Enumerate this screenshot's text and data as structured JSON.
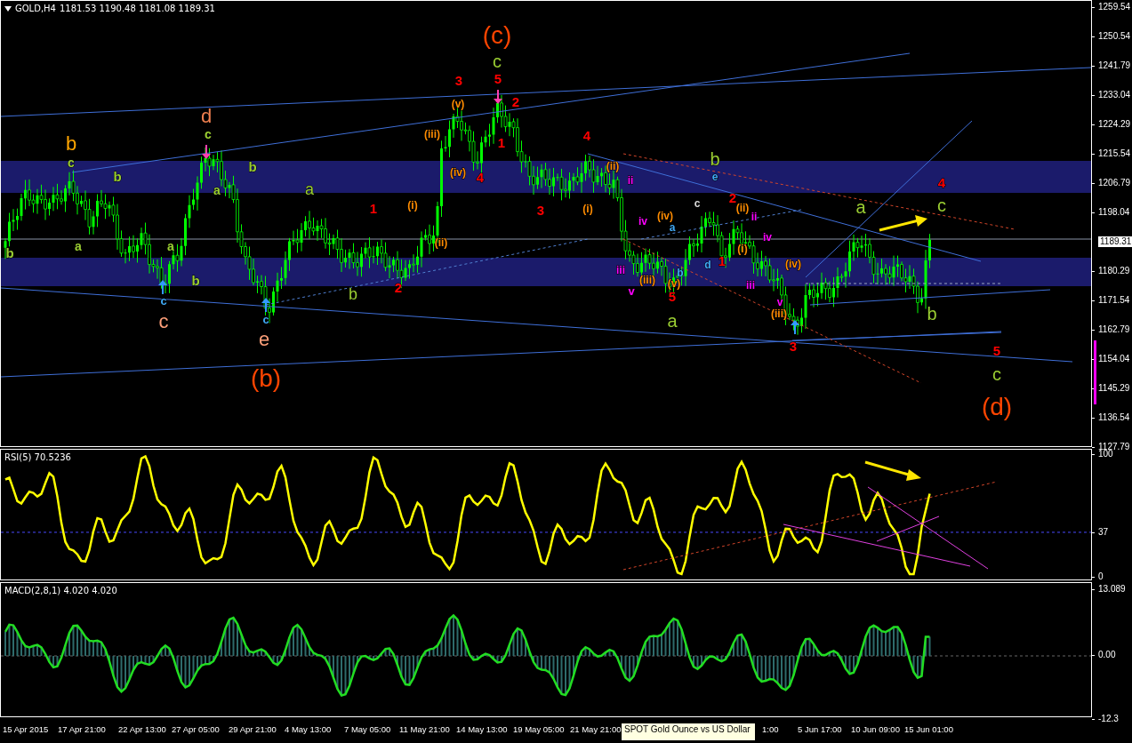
{
  "chart": {
    "symbol": "GOLD,H4",
    "ohlc": [
      "1181.53",
      "1190.48",
      "1181.08",
      "1189.31"
    ],
    "price_axis": [
      "1259.54",
      "1250.54",
      "1241.79",
      "1233.04",
      "1224.29",
      "1215.54",
      "1206.79",
      "1198.04",
      "1180.29",
      "1171.54",
      "1162.79",
      "1154.04",
      "1145.29",
      "1136.54",
      "1127.79"
    ],
    "current_price": "1189.31",
    "wave_labels": [
      {
        "text": "(c)",
        "color": "#ff4500"
      },
      {
        "text": "c",
        "color": "#9acd32"
      },
      {
        "text": "3",
        "color": "#ff0000"
      },
      {
        "text": "5",
        "color": "#ff0000"
      },
      {
        "text": "2",
        "color": "#ff0000"
      },
      {
        "text": "(v)",
        "color": "#ff8c00"
      },
      {
        "text": "d",
        "color": "#f08050"
      },
      {
        "text": "c",
        "color": "#9acd32"
      },
      {
        "text": "b",
        "color": "#ffa500"
      },
      {
        "text": "c",
        "color": "#9acd32"
      },
      {
        "text": "b",
        "color": "#9acd32"
      },
      {
        "text": "b",
        "color": "#9acd32"
      },
      {
        "text": "a",
        "color": "#9acd32"
      },
      {
        "text": "a",
        "color": "#9acd32"
      },
      {
        "text": "(iii)",
        "color": "#ff8c00"
      },
      {
        "text": "(iv)",
        "color": "#ff8c00"
      },
      {
        "text": "4",
        "color": "#ff0000"
      },
      {
        "text": "1",
        "color": "#ff0000"
      },
      {
        "text": "4",
        "color": "#ff0000"
      },
      {
        "text": "1",
        "color": "#ff0000"
      },
      {
        "text": "3",
        "color": "#ff0000"
      },
      {
        "text": "(i)",
        "color": "#ff8c00"
      },
      {
        "text": "(ii)",
        "color": "#ff8c00"
      },
      {
        "text": "b",
        "color": "#9acd32"
      },
      {
        "text": "a",
        "color": "#9acd32"
      },
      {
        "text": "a",
        "color": "#9acd32"
      },
      {
        "text": "b",
        "color": "#9acd32"
      },
      {
        "text": "c",
        "color": "#3fa9f5"
      },
      {
        "text": "c",
        "color": "#ffa07a"
      },
      {
        "text": "b",
        "color": "#9acd32"
      },
      {
        "text": "2",
        "color": "#ff0000"
      },
      {
        "text": "c",
        "color": "#3fa9f5"
      },
      {
        "text": "e",
        "color": "#ffa07a"
      },
      {
        "text": "(b)",
        "color": "#ff4500"
      },
      {
        "text": "(ii)",
        "color": "#ff8c00"
      },
      {
        "text": "ii",
        "color": "#ff00ff"
      },
      {
        "text": "(i)",
        "color": "#ff8c00"
      },
      {
        "text": "b",
        "color": "#9acd32"
      },
      {
        "text": "e",
        "color": "#3fa9f5"
      },
      {
        "text": "2",
        "color": "#ff0000"
      },
      {
        "text": "c",
        "color": "#d8d8d8"
      },
      {
        "text": "iv",
        "color": "#ff00ff"
      },
      {
        "text": "(iv)",
        "color": "#ff8c00"
      },
      {
        "text": "a",
        "color": "#3fa9f5"
      },
      {
        "text": "(ii)",
        "color": "#ff8c00"
      },
      {
        "text": "ii",
        "color": "#ff00ff"
      },
      {
        "text": "iv",
        "color": "#ff00ff"
      },
      {
        "text": "(i)",
        "color": "#ff8c00"
      },
      {
        "text": "b",
        "color": "#3fa9f5"
      },
      {
        "text": "d",
        "color": "#3fa9f5"
      },
      {
        "text": "1",
        "color": "#ff0000"
      },
      {
        "text": "iii",
        "color": "#ff00ff"
      },
      {
        "text": "v",
        "color": "#ff00ff"
      },
      {
        "text": "(iii)",
        "color": "#ff8c00"
      },
      {
        "text": "(v)",
        "color": "#ff8c00"
      },
      {
        "text": "5",
        "color": "#ff0000"
      },
      {
        "text": "iii",
        "color": "#ff00ff"
      },
      {
        "text": "(iv)",
        "color": "#ff8c00"
      },
      {
        "text": "v",
        "color": "#ff00ff"
      },
      {
        "text": "(iii)",
        "color": "#ff8c00"
      },
      {
        "text": "a",
        "color": "#9acd32"
      },
      {
        "text": "3",
        "color": "#ff0000"
      },
      {
        "text": "4",
        "color": "#ff0000"
      },
      {
        "text": "a",
        "color": "#9acd32"
      },
      {
        "text": "c",
        "color": "#9acd32"
      },
      {
        "text": "b",
        "color": "#9acd32"
      },
      {
        "text": "5",
        "color": "#ff0000"
      },
      {
        "text": "c",
        "color": "#9acd32"
      },
      {
        "text": "(d)",
        "color": "#ff4500"
      }
    ]
  },
  "rsi": {
    "title": "RSI(5) 70.5236",
    "axis": [
      "100",
      "37",
      "0"
    ]
  },
  "macd": {
    "title": "MACD(2,8,1) 4.020 4.020",
    "axis": [
      "13.089",
      "0.00",
      "-12.3"
    ]
  },
  "time_axis": [
    "15 Apr 2015",
    "17 Apr 21:00",
    "22 Apr 13:00",
    "27 Apr 05:00",
    "29 Apr 21:00",
    "4 May 13:00",
    "7 May 05:00",
    "11 May 21:00",
    "14 May 13:00",
    "19 May 05:00",
    "21 May 21:00",
    "1:00",
    "5 Jun 17:00",
    "10 Jun 09:00",
    "15 Jun 01:00"
  ],
  "tooltip": {
    "text": "SPOT Gold Ounce vs US Dollar"
  }
}
